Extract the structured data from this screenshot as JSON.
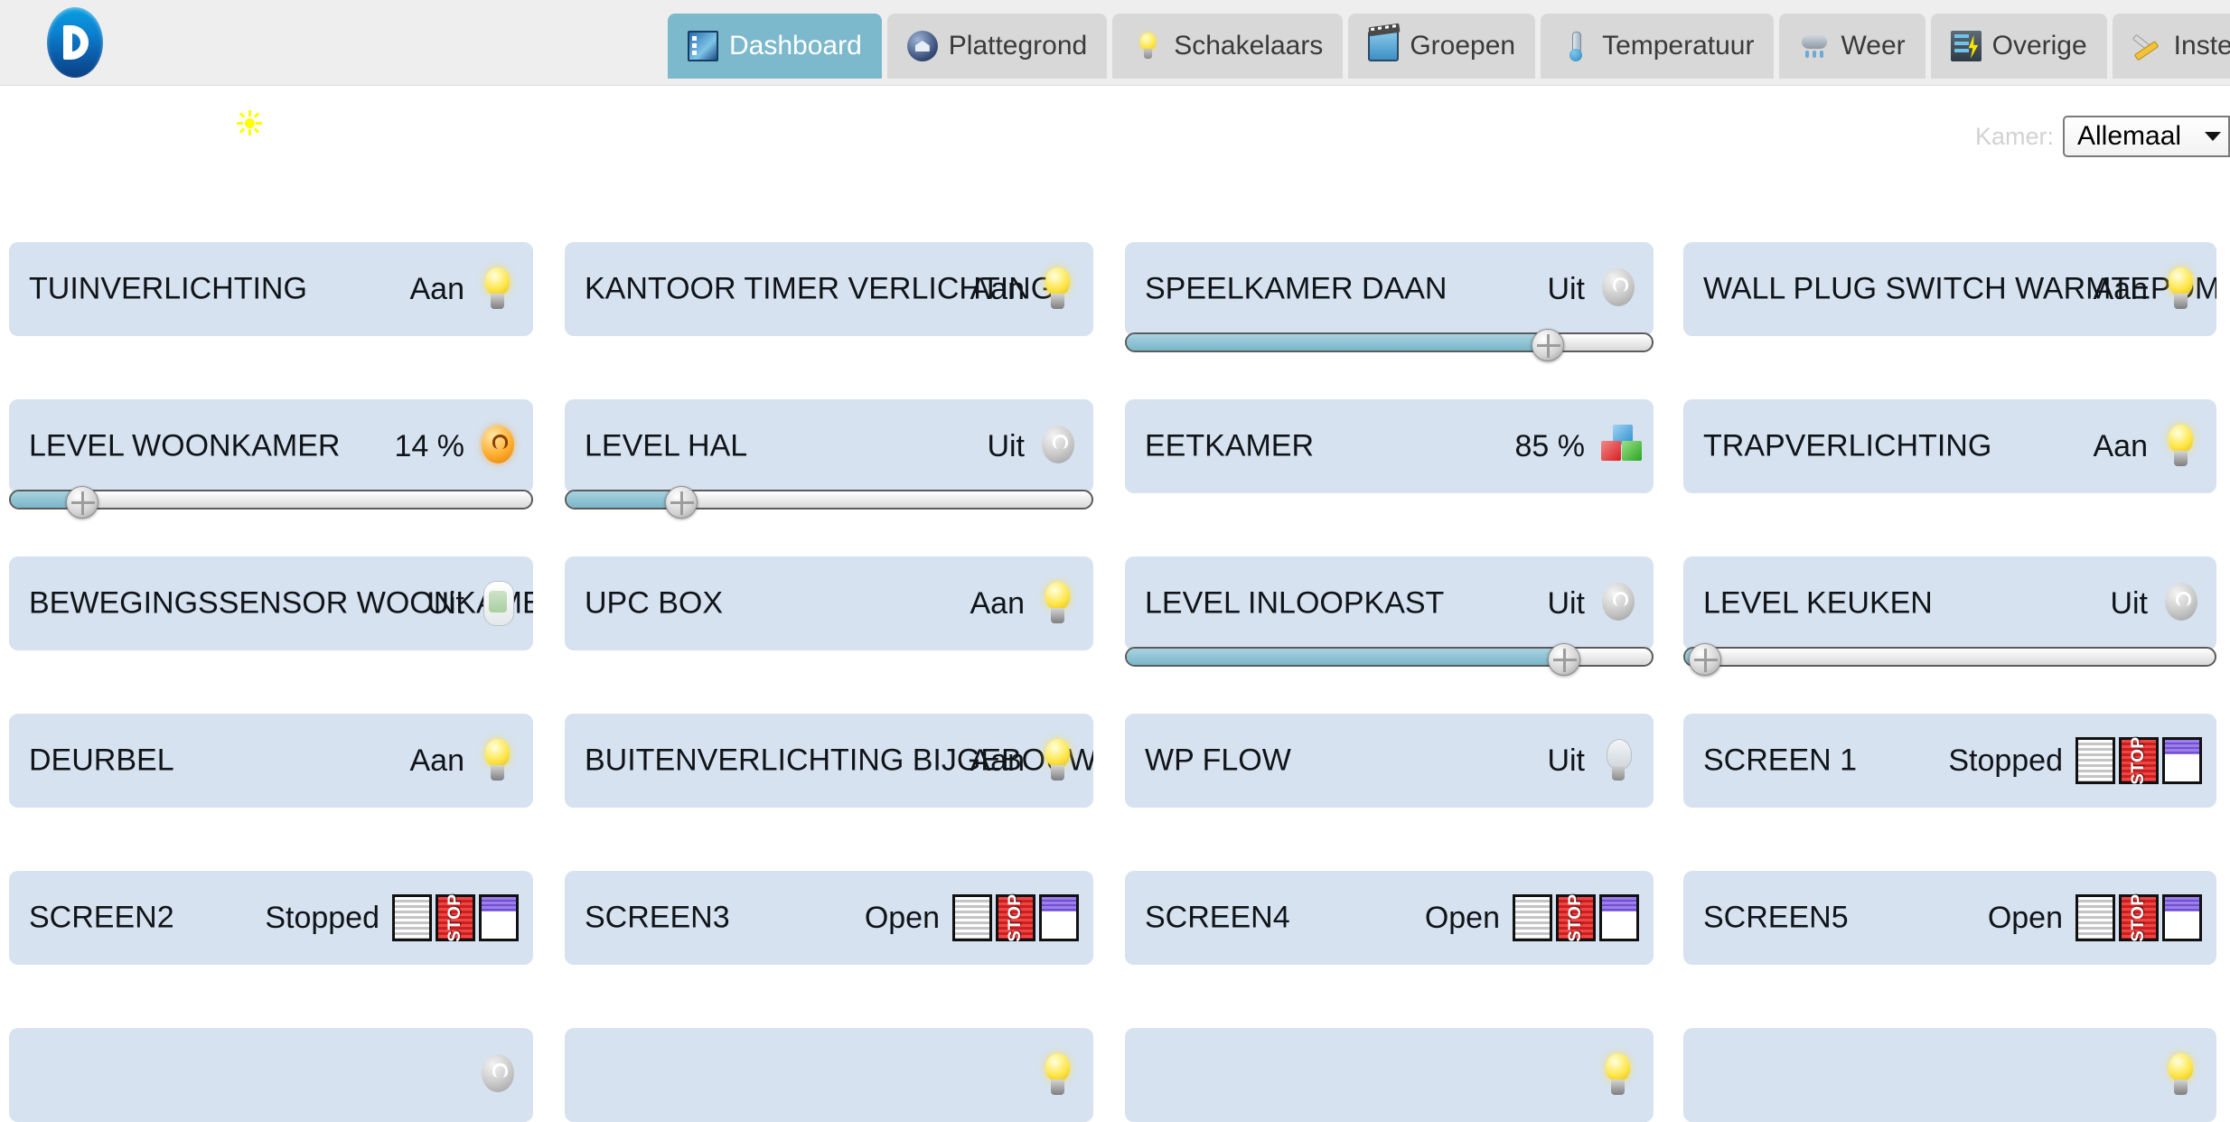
{
  "app": {
    "logo_name": "domoticz-logo"
  },
  "nav": {
    "tabs": [
      {
        "label": "Dashboard",
        "icon": "dashboard-icon",
        "active": true,
        "caret": false
      },
      {
        "label": "Plattegrond",
        "icon": "floorplan-icon",
        "active": false,
        "caret": false
      },
      {
        "label": "Schakelaars",
        "icon": "lightbulb-icon",
        "active": false,
        "caret": false
      },
      {
        "label": "Groepen",
        "icon": "movie-clap-icon",
        "active": false,
        "caret": false
      },
      {
        "label": "Temperatuur",
        "icon": "thermometer-icon",
        "active": false,
        "caret": false
      },
      {
        "label": "Weer",
        "icon": "rain-cloud-icon",
        "active": false,
        "caret": false
      },
      {
        "label": "Overige",
        "icon": "server-bolt-icon",
        "active": false,
        "caret": false
      },
      {
        "label": "Instellingen",
        "icon": "tools-icon",
        "active": false,
        "caret": true
      }
    ]
  },
  "subheader": {
    "sun_icon": "sun-icon",
    "room_filter": {
      "label": "Kamer:",
      "value": "Allemaal"
    }
  },
  "devices": [
    {
      "name": "TUINVERLICHTING",
      "state": "Aan",
      "icon": "bulb-on",
      "type": "switch",
      "col": 0,
      "row": 0
    },
    {
      "name": "KANTOOR TIMER VERLICHTING",
      "state": "Aan",
      "icon": "bulb-on",
      "type": "switch",
      "col": 1,
      "row": 0
    },
    {
      "name": "SPEELKAMER DAAN",
      "state": "Uit",
      "icon": "bulb-off",
      "type": "dimmer",
      "col": 2,
      "row": 0,
      "slider": 80
    },
    {
      "name": "WALL PLUG SWITCH WARMTEPOMP",
      "state": "Aan",
      "icon": "bulb-on",
      "type": "switch",
      "col": 3,
      "row": 0
    },
    {
      "name": "LEVEL WOONKAMER",
      "state": "14 %",
      "icon": "bulb-dim",
      "type": "dimmer",
      "col": 0,
      "row": 1,
      "slider": 14
    },
    {
      "name": "LEVEL HAL",
      "state": "Uit",
      "icon": "bulb-off",
      "type": "dimmer",
      "col": 1,
      "row": 1,
      "slider": 22
    },
    {
      "name": "EETKAMER",
      "state": "85 %",
      "icon": "rgb-cubes",
      "type": "group",
      "col": 2,
      "row": 1
    },
    {
      "name": "TRAPVERLICHTING",
      "state": "Aan",
      "icon": "bulb-on",
      "type": "switch",
      "col": 3,
      "row": 1
    },
    {
      "name": "BEWEGINGSSENSOR WOONKAMER",
      "state": "Uit",
      "icon": "motion",
      "type": "sensor",
      "col": 0,
      "row": 2
    },
    {
      "name": "UPC BOX",
      "state": "Aan",
      "icon": "bulb-on",
      "type": "switch",
      "col": 1,
      "row": 2
    },
    {
      "name": "LEVEL INLOOPKAST",
      "state": "Uit",
      "icon": "bulb-off",
      "type": "dimmer",
      "col": 2,
      "row": 2,
      "slider": 83
    },
    {
      "name": "LEVEL KEUKEN",
      "state": "Uit",
      "icon": "bulb-off",
      "type": "dimmer",
      "col": 3,
      "row": 2,
      "slider": 4
    },
    {
      "name": "DEURBEL",
      "state": "Aan",
      "icon": "bulb-on",
      "type": "switch",
      "col": 0,
      "row": 3
    },
    {
      "name": "BUITENVERLICHTING BIJGEBOUW",
      "state": "Aan",
      "icon": "bulb-on",
      "type": "switch",
      "col": 1,
      "row": 3
    },
    {
      "name": "WP FLOW",
      "state": "Uit",
      "icon": "bulb-clear",
      "type": "switch",
      "col": 2,
      "row": 3
    },
    {
      "name": "SCREEN 1",
      "state": "Stopped",
      "icon": "blinds",
      "type": "blind",
      "col": 3,
      "row": 3
    },
    {
      "name": "SCREEN2",
      "state": "Stopped",
      "icon": "blinds",
      "type": "blind",
      "col": 0,
      "row": 4
    },
    {
      "name": "SCREEN3",
      "state": "Open",
      "icon": "blinds",
      "type": "blind",
      "col": 1,
      "row": 4
    },
    {
      "name": "SCREEN4",
      "state": "Open",
      "icon": "blinds",
      "type": "blind",
      "col": 2,
      "row": 4
    },
    {
      "name": "SCREEN5",
      "state": "Open",
      "icon": "blinds",
      "type": "blind",
      "col": 3,
      "row": 4
    },
    {
      "name": "",
      "state": "",
      "icon": "bulb-off",
      "type": "switch",
      "col": 0,
      "row": 5
    },
    {
      "name": "",
      "state": "",
      "icon": "bulb-on",
      "type": "switch",
      "col": 1,
      "row": 5
    },
    {
      "name": "",
      "state": "",
      "icon": "bulb-on",
      "type": "switch",
      "col": 2,
      "row": 5
    },
    {
      "name": "",
      "state": "",
      "icon": "bulb-on",
      "type": "switch",
      "col": 3,
      "row": 5
    }
  ],
  "blind_buttons": {
    "down_label": "",
    "stop_label": "STOP",
    "up_label": ""
  },
  "colors": {
    "card_bg": "#d6e2f0",
    "active_tab": "#7cb9cd",
    "tab_bg": "#d8d8d8",
    "topbar_bg": "#eeeeee",
    "slider_fill": "#79b6c9",
    "stop_red": "#d81f1f",
    "blind_up_purple": "#6f4fd6"
  }
}
